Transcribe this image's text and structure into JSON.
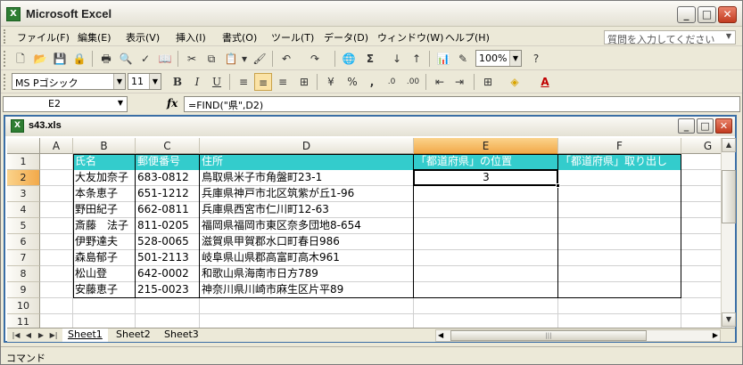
{
  "window": {
    "title": "Microsoft Excel",
    "app_icon": "excel-icon",
    "minimize_icon": "minimize-icon",
    "maximize_icon": "maximize-icon",
    "close_icon": "close-icon"
  },
  "menubar": {
    "items": [
      "ファイル(F)",
      "編集(E)",
      "表示(V)",
      "挿入(I)",
      "書式(O)",
      "ツール(T)",
      "データ(D)",
      "ウィンドウ(W)",
      "ヘルプ(H)"
    ],
    "help_placeholder": "質問を入力してください"
  },
  "standard_toolbar": {
    "zoom": "100%"
  },
  "formatting_toolbar": {
    "font_name": "MS Pゴシック",
    "font_size": "11",
    "bold": "B",
    "italic": "I",
    "underline": "U"
  },
  "formula_bar": {
    "name_box": "E2",
    "fx": "fx",
    "formula": "=FIND(\"県\",D2)"
  },
  "workbook": {
    "title": "s43.xls",
    "columns": [
      "A",
      "B",
      "C",
      "D",
      "E",
      "F",
      "G"
    ],
    "active_column": "E",
    "rows": [
      "1",
      "2",
      "3",
      "4",
      "5",
      "6",
      "7",
      "8",
      "9",
      "10",
      "11"
    ],
    "active_row": "2",
    "header_row": [
      "氏名",
      "郵便番号",
      "住所",
      "「都道府県」の位置",
      "「都道府県」取り出し"
    ],
    "data_rows": [
      [
        "大友加奈子",
        "683-0812",
        "鳥取県米子市角盤町23-1",
        "3",
        ""
      ],
      [
        "本条恵子",
        "651-1212",
        "兵庫県神戸市北区筑紫が丘1-96",
        "",
        ""
      ],
      [
        "野田紀子",
        "662-0811",
        "兵庫県西宮市仁川町12-63",
        "",
        ""
      ],
      [
        "斎藤　法子",
        "811-0205",
        "福岡県福岡市東区奈多団地8-654",
        "",
        ""
      ],
      [
        "伊野達夫",
        "528-0065",
        "滋賀県甲賀郡水口町春日986",
        "",
        ""
      ],
      [
        "森島郁子",
        "501-2113",
        "岐阜県山県郡高富町高木961",
        "",
        ""
      ],
      [
        "松山登",
        "642-0002",
        "和歌山県海南市日方789",
        "",
        ""
      ],
      [
        "安藤恵子",
        "215-0023",
        "神奈川県川崎市麻生区片平89",
        "",
        ""
      ]
    ],
    "sheets": [
      "Sheet1",
      "Sheet2",
      "Sheet3"
    ],
    "active_sheet": "Sheet1"
  },
  "status": {
    "text": "コマンド"
  },
  "colors": {
    "header_fill": "#33cccc",
    "active_header": "#f2a94a"
  }
}
